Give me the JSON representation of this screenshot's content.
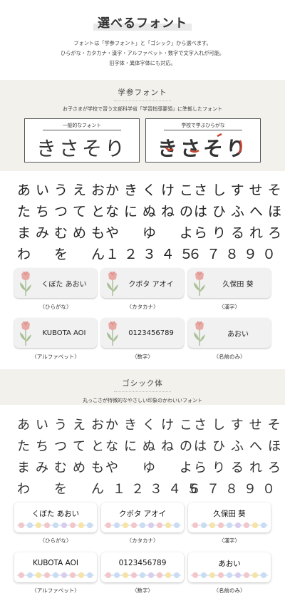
{
  "header": {
    "title": "選べるフォント",
    "intro": [
      "フォントは「学参フォント」と「ゴシック」から選べます。",
      "ひらがな・カタカナ・漢字・アルファベット・数字で文字入れが可能。",
      "旧字体・異体字体にも対応。"
    ]
  },
  "gakusan": {
    "title": "学参フォント",
    "subtitle": "お子さまが学校で習う文部科学省「学習指導要領」に準拠したフォント",
    "compare": [
      {
        "label": "一般的なフォント",
        "sample": "きさそり"
      },
      {
        "label": "学校で学ぶひらがな",
        "sample": "きさそり"
      }
    ],
    "grid": [
      [
        "あいうえお",
        "かきくけこ",
        "さしすせそ"
      ],
      [
        "たちつてと",
        "なにぬねの",
        "はひふへほ"
      ],
      [
        "まみむめも",
        "や　ゆ　よ",
        "らりるれろ"
      ],
      [
        "わ　を　ん",
        "１２３４５",
        "６７８９０"
      ]
    ],
    "cards": [
      {
        "text": "くぼた あおい",
        "caption": "〈ひらがな〉"
      },
      {
        "text": "クボタ アオイ",
        "caption": "〈カタカナ〉"
      },
      {
        "text": "久保田 葵",
        "caption": "〈漢字〉"
      },
      {
        "text": "KUBOTA AOI",
        "caption": "〈アルファベット〉"
      },
      {
        "text": "0123456789",
        "caption": "〈数字〉"
      },
      {
        "text": "あおい",
        "caption": "〈名前のみ〉"
      }
    ]
  },
  "gothic": {
    "title": "ゴシック体",
    "subtitle": "丸っこさが特徴的なやさしい印象のかわいいフォント",
    "grid": [
      [
        "あいうえお",
        "かきくけこ",
        "さしすせそ"
      ],
      [
        "たちつてと",
        "なにぬねの",
        "はひふへほ"
      ],
      [
        "まみむめも",
        "や　ゆ　よ",
        "らりるれろ"
      ],
      [
        "わ　を　ん",
        "１２３４５",
        "６７８９０"
      ]
    ],
    "cards": [
      {
        "text": "くぼた あおい",
        "caption": "〈ひらがな〉"
      },
      {
        "text": "クボタ アオイ",
        "caption": "〈カタカナ〉"
      },
      {
        "text": "久保田 葵",
        "caption": "〈漢字〉"
      },
      {
        "text": "KUBOTA AOI",
        "caption": "〈アルファベット〉"
      },
      {
        "text": "0123456789",
        "caption": "〈数字〉"
      },
      {
        "text": "あおい",
        "caption": "〈名前のみ〉"
      }
    ]
  },
  "colors": {
    "band": "#f2f1ec",
    "tulip_pink": "#e8a9a4",
    "leaf_green": "#9cb38a",
    "stroke_red": "#c9432e"
  }
}
